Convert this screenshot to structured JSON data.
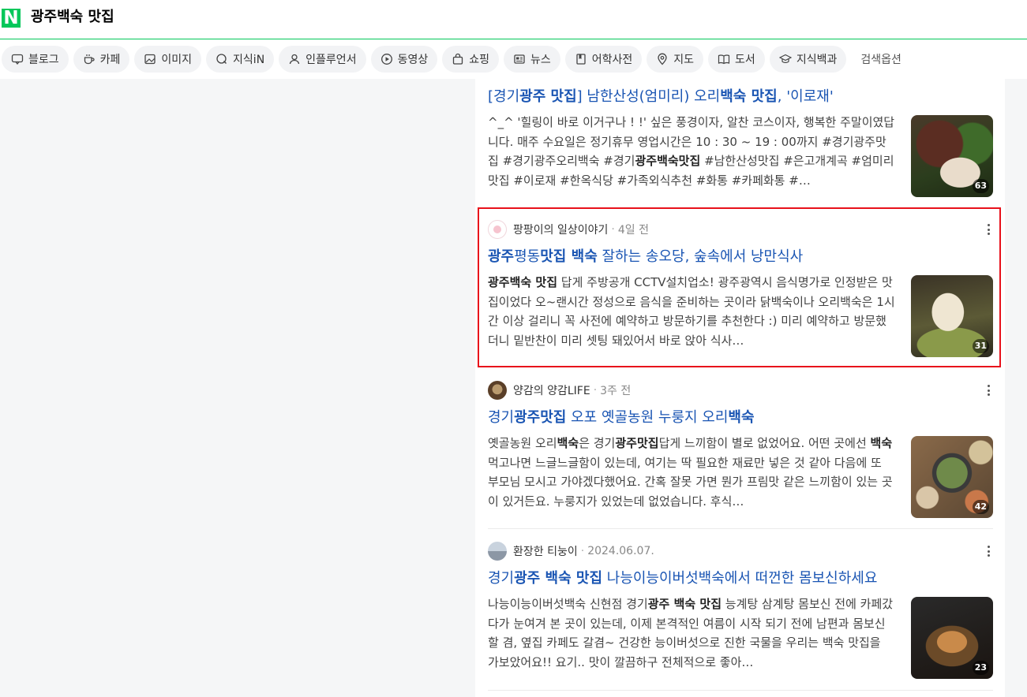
{
  "search": {
    "logo": "N",
    "query": "광주백숙 맛집"
  },
  "tabs": [
    {
      "label": "블로그",
      "icon": "blog-icon"
    },
    {
      "label": "카페",
      "icon": "cafe-icon"
    },
    {
      "label": "이미지",
      "icon": "image-icon"
    },
    {
      "label": "지식iN",
      "icon": "qa-icon"
    },
    {
      "label": "인플루언서",
      "icon": "person-icon"
    },
    {
      "label": "동영상",
      "icon": "play-icon"
    },
    {
      "label": "쇼핑",
      "icon": "bag-icon"
    },
    {
      "label": "뉴스",
      "icon": "news-icon"
    },
    {
      "label": "어학사전",
      "icon": "book-icon"
    },
    {
      "label": "지도",
      "icon": "map-pin-icon"
    },
    {
      "label": "도서",
      "icon": "open-book-icon"
    },
    {
      "label": "지식백과",
      "icon": "grad-cap-icon"
    },
    {
      "label": "검색옵션"
    }
  ],
  "results": [
    {
      "title": [
        {
          "t": "[경기"
        },
        {
          "t": "광주 맛집",
          "b": true
        },
        {
          "t": "] 남한산성(엄미리) 오리"
        },
        {
          "t": "백숙 맛집",
          "b": true
        },
        {
          "t": ", '이로재'"
        }
      ],
      "desc": [
        {
          "t": "^_^ '힐링이 바로 이거구나 ! !' 싶은 풍경이자, 알찬 코스이자, 행복한 주말이였답니다. 매주 수요일은 정기휴무 영업시간은 10 : 30 ~ 19 : 00까지 #경기광주맛집 #경기광주오리백숙 #경기"
        },
        {
          "t": "광주백숙맛집",
          "b": true
        },
        {
          "t": " #남한산성맛집 #은고개계곡 #엄미리맛집 #이로재 #한옥식당 #가족외식추천 #화통 #카페화통 #…"
        }
      ],
      "image_count": "63"
    },
    {
      "author": "팡팡이의 일상이야기",
      "time": "4일 전",
      "title": [
        {
          "t": "광주",
          "b": true
        },
        {
          "t": "평동"
        },
        {
          "t": "맛집 백숙",
          "b": true
        },
        {
          "t": " 잘하는 송오당, 숲속에서 낭만식사"
        }
      ],
      "desc": [
        {
          "t": "광주백숙 맛집",
          "b": true
        },
        {
          "t": " 답게 주방공개 CCTV설치업소! 광주광역시 음식명가로 인정받은 맛집이었다 오~랜시간 정성으로 음식을 준비하는 곳이라 닭백숙이나 오리백숙은 1시간 이상 걸리니 꼭 사전에 예약하고 방문하기를 추천한다 :) 미리 예약하고 방문했더니 밑반찬이 미리 셋팅 돼있어서 바로 앉아 식사…"
        }
      ],
      "image_count": "31"
    },
    {
      "author": "양감의 양감LIFE",
      "time": "3주 전",
      "title": [
        {
          "t": "경기"
        },
        {
          "t": "광주맛집",
          "b": true
        },
        {
          "t": " 오포 옛골농원 누룽지 오리"
        },
        {
          "t": "백숙",
          "b": true
        }
      ],
      "desc": [
        {
          "t": "옛골농원 오리"
        },
        {
          "t": "백숙",
          "b": true
        },
        {
          "t": "은 경기"
        },
        {
          "t": "광주맛집",
          "b": true
        },
        {
          "t": "답게 느끼함이 별로 없었어요. 어떤 곳에선 "
        },
        {
          "t": "백숙",
          "b": true
        },
        {
          "t": " 먹고나면 느글느글함이 있는데, 여기는 딱 필요한 재료만 넣은 것 같아 다음에 또 부모님 모시고 가야겠다했어요. 간혹 잘못 가면 뭔가 프림맛 같은 느끼함이 있는 곳이 있거든요. 누룽지가 있었는데 없었습니다. 후식…"
        }
      ],
      "image_count": "42"
    },
    {
      "author": "환장한 티눙이",
      "time": "2024.06.07.",
      "title": [
        {
          "t": "경기"
        },
        {
          "t": "광주 백숙 맛집",
          "b": true
        },
        {
          "t": " 나능이능이버섯백숙에서 떠껀한 몸보신하세요"
        }
      ],
      "desc": [
        {
          "t": "나능이능이버섯백숙 신현점 경기"
        },
        {
          "t": "광주 백숙 맛집",
          "b": true
        },
        {
          "t": " 능계탕 삼계탕 몸보신 전에 카페갔다가 눈여겨 본 곳이 있는데, 이제 본격적인 여름이 시작 되기 전에 남편과 몸보신 할 겸, 옆집 카페도 갈겸~ 건강한 능이버섯으로 진한 국물을 우리는 백숙 맛집을 가보았어요!! 요기.. 맛이 깔끔하구 전체적으로 좋아…"
        }
      ],
      "image_count": "23"
    }
  ]
}
